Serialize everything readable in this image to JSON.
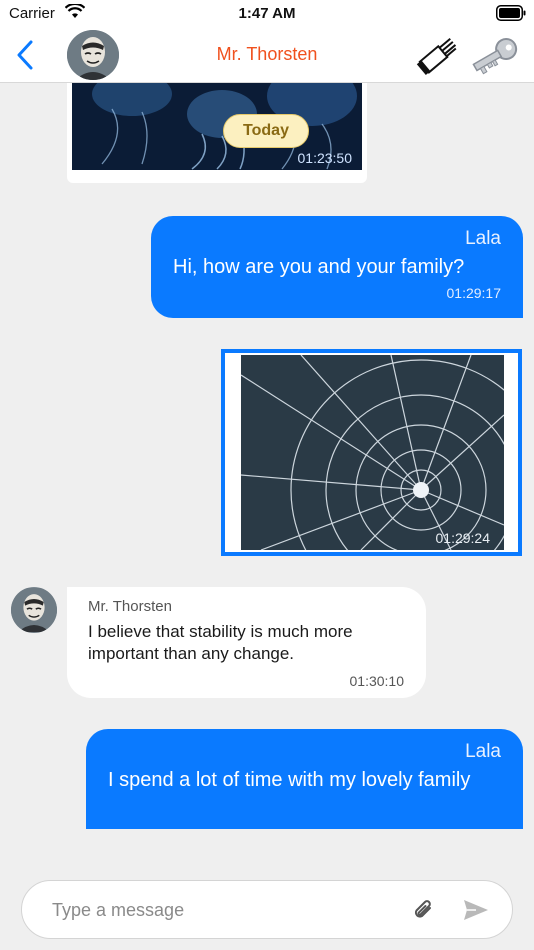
{
  "status_bar": {
    "carrier": "Carrier",
    "time": "1:47 AM"
  },
  "header": {
    "title": "Mr. Thorsten"
  },
  "messages": {
    "image_incoming": {
      "time": "01:23:50"
    },
    "date_divider": "Today",
    "out1": {
      "sender": "Lala",
      "text": "Hi, how are you and your family?",
      "time": "01:29:17"
    },
    "image_outgoing": {
      "time": "01:29:24"
    },
    "in1": {
      "sender": "Mr. Thorsten",
      "text": "I believe that stability is much more important than any change.",
      "time": "01:30:10"
    },
    "out2": {
      "sender": "Lala",
      "text": "I spend a lot of time with my lovely family"
    }
  },
  "composer": {
    "placeholder": "Type a message"
  },
  "colors": {
    "accent": "#0a7aff",
    "title": "#f0511e",
    "background": "#efefef"
  },
  "icons": [
    "wifi-icon",
    "battery-icon",
    "back-chevron-icon",
    "brush-icon",
    "key-icon",
    "paperclip-icon",
    "send-icon"
  ]
}
